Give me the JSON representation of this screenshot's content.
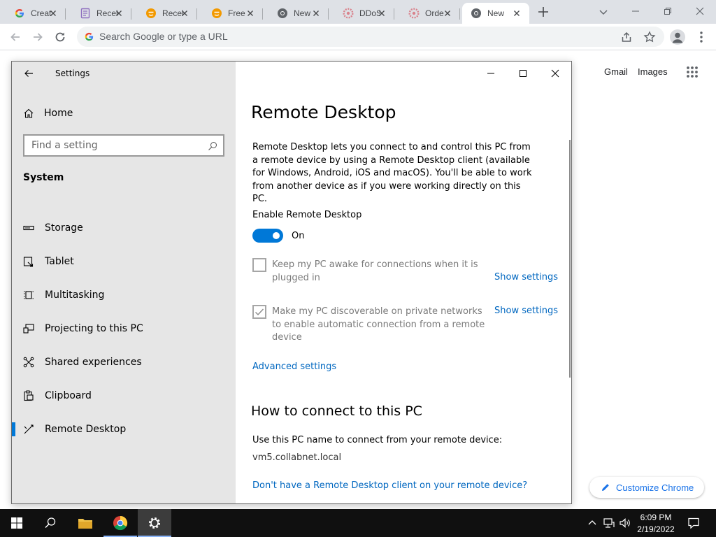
{
  "browser": {
    "tabs": [
      {
        "title": "Creat",
        "icon": "google-g-icon",
        "active": false
      },
      {
        "title": "Recei",
        "icon": "receipt-favicon-icon",
        "active": false
      },
      {
        "title": "Recei",
        "icon": "orange-emoji-favicon-icon",
        "active": false
      },
      {
        "title": "Free",
        "icon": "orange-emoji-favicon-icon",
        "active": false
      },
      {
        "title": "New",
        "icon": "chrome-favicon-icon",
        "active": false
      },
      {
        "title": "DDoS",
        "icon": "pink-gear-favicon-icon",
        "active": false
      },
      {
        "title": "Orde",
        "icon": "pink-gear-favicon-icon",
        "active": false
      },
      {
        "title": "New",
        "icon": "chrome-favicon-icon",
        "active": true
      }
    ],
    "omnibox_placeholder": "Search Google or type a URL"
  },
  "ntp": {
    "gmail": "Gmail",
    "images": "Images",
    "customize": "Customize Chrome"
  },
  "settings": {
    "window_title": "Settings",
    "home": "Home",
    "search_placeholder": "Find a setting",
    "section": "System",
    "nav": [
      {
        "label": "Storage",
        "icon": "storage-icon"
      },
      {
        "label": "Tablet",
        "icon": "tablet-icon"
      },
      {
        "label": "Multitasking",
        "icon": "multitasking-icon"
      },
      {
        "label": "Projecting to this PC",
        "icon": "projecting-icon"
      },
      {
        "label": "Shared experiences",
        "icon": "shared-experiences-icon"
      },
      {
        "label": "Clipboard",
        "icon": "clipboard-icon"
      },
      {
        "label": "Remote Desktop",
        "icon": "remote-desktop-icon",
        "active": true
      }
    ],
    "page": {
      "title": "Remote Desktop",
      "description": "Remote Desktop lets you connect to and control this PC from a remote device by using a Remote Desktop client (available for Windows, Android, iOS and macOS). You'll be able to work from another device as if you were working directly on this PC.",
      "enable_label": "Enable Remote Desktop",
      "toggle_state": "On",
      "checkbox_awake": "Keep my PC awake for connections when it is plugged in",
      "checkbox_awake_checked": false,
      "checkbox_discoverable": "Make my PC discoverable on private networks to enable automatic connection from a remote device",
      "checkbox_discoverable_checked": true,
      "show_settings": "Show settings",
      "advanced": "Advanced settings",
      "howto_title": "How to connect to this PC",
      "use_name": "Use this PC name to connect from your remote device:",
      "pc_name": "vm5.collabnet.local",
      "no_client": "Don't have a Remote Desktop client on your remote device?"
    }
  },
  "taskbar": {
    "time": "6:09 PM",
    "date": "2/19/2022"
  },
  "colors": {
    "accent": "#0078d7",
    "link": "#0067c0",
    "chrome_link": "#1a73e8",
    "taskbar": "#101010"
  }
}
